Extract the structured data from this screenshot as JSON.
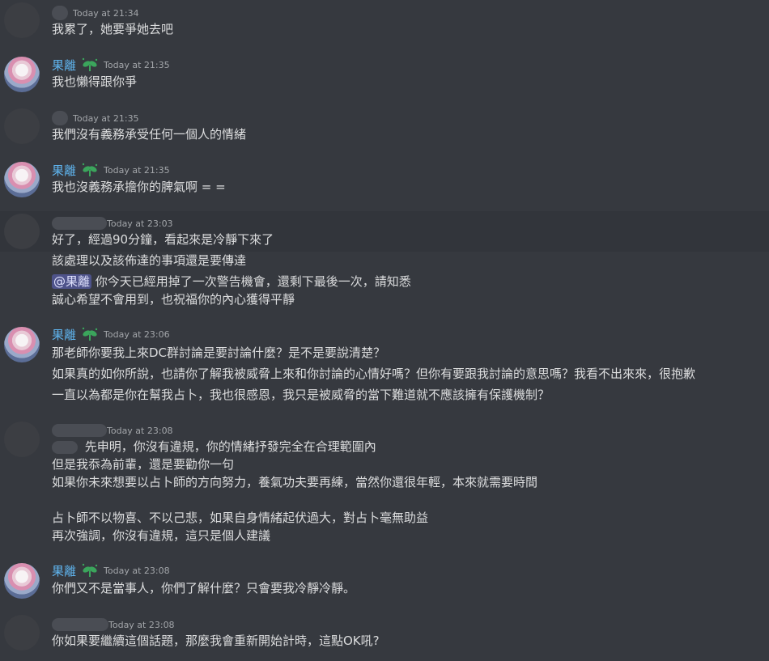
{
  "messages": [
    {
      "author": "",
      "time": "Today at 21:34",
      "lines": [
        "我累了，她要爭她去吧"
      ]
    },
    {
      "author": "果離",
      "time": "Today at 21:35",
      "lines": [
        "我也懶得跟你爭"
      ]
    },
    {
      "author": "",
      "time": "Today at 21:35",
      "lines": [
        "我們沒有義務承受任何一個人的情緒"
      ]
    },
    {
      "author": "果離",
      "time": "Today at 21:35",
      "lines": [
        "我也沒義務承擔你的脾氣啊 = ="
      ]
    },
    {
      "author": "",
      "time": "Today at 23:03",
      "lines": [
        "好了，經過90分鐘，看起來是冷靜下來了",
        "該處理以及該佈達的事項還是要傳達",
        "你今天已經用掉了一次警告機會，還剩下最後一次，請知悉",
        "誠心希望不會用到，也祝福你的內心獲得平靜"
      ],
      "mention": "@果離"
    },
    {
      "author": "果離",
      "time": "Today at 23:06",
      "lines": [
        "那老師你要我上來DC群討論是要討論什麼？是不是要說清楚？",
        "如果真的如你所說，也請你了解我被威脅上來和你討論的心情好嗎？但你有要跟我討論的意思嗎？我看不出來來，很抱歉",
        "一直以為都是你在幫我占卜，我也很感恩，我只是被威脅的當下難道就不應該擁有保護機制？"
      ]
    },
    {
      "author": "",
      "time": "Today at 23:08",
      "lines": [
        "先申明，你沒有違規，你的情緒抒發完全在合理範圍內",
        "但是我忝為前輩，還是要勸你一句",
        "如果你未來想要以占卜師的方向努力，養氣功夫要再練，當然你還很年輕，本來就需要時間",
        "占卜師不以物喜、不以己悲，如果自身情緒起伏過大，對占卜毫無助益",
        "再次強調，你沒有違規，這只是個人建議"
      ]
    },
    {
      "author": "果離",
      "time": "Today at 23:08",
      "lines": [
        "你們又不是當事人，你們了解什麼？只會要我冷靜冷靜。"
      ]
    },
    {
      "author": "",
      "time": "Today at 23:08",
      "lines": [
        "你如果要繼續這個話題，那麼我會重新開始計時，這點OK吼?"
      ]
    }
  ],
  "colors": {
    "background": "#36393f",
    "username": "#5fb4ee",
    "timestamp": "#a3a6aa",
    "text": "#dcddde",
    "mention_bg": "#4e538a",
    "role_icon": "#3ba55c"
  },
  "icons": {
    "role_badge": "sprout-icon",
    "avatar_redacted": "blurred-avatar",
    "avatar_user": "anime-avatar"
  }
}
